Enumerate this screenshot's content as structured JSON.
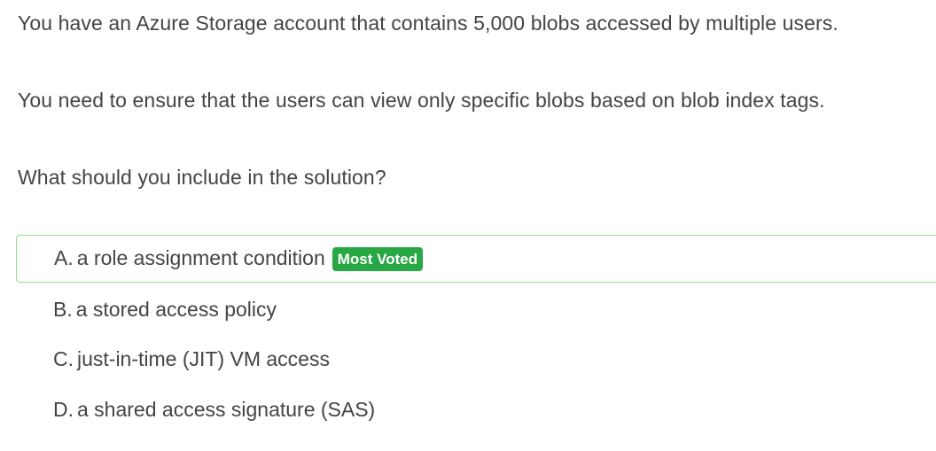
{
  "question": {
    "lines": [
      "You have an Azure Storage account that contains 5,000 blobs accessed by multiple users.",
      "You need to ensure that the users can view only specific blobs based on blob index tags.",
      "What should you include in the solution?"
    ]
  },
  "choices": [
    {
      "letter": "A.",
      "text": "a role assignment condition",
      "badge": "Most Voted"
    },
    {
      "letter": "B.",
      "text": "a stored access policy"
    },
    {
      "letter": "C.",
      "text": "just-in-time (JIT) VM access"
    },
    {
      "letter": "D.",
      "text": "a shared access signature (SAS)"
    }
  ],
  "colors": {
    "text": "#444444",
    "badge_bg": "#28a745",
    "voted_border": "#8fe08f"
  }
}
